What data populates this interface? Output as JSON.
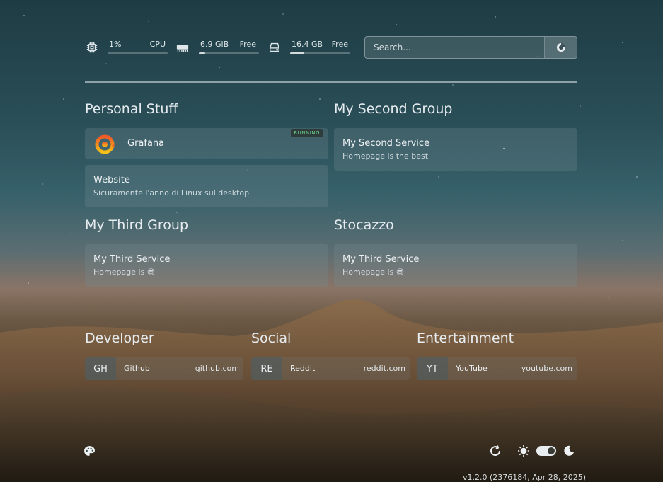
{
  "resources": {
    "cpu": {
      "value": "1%",
      "label": "CPU",
      "usage": 0.01,
      "icon": "cpu-icon"
    },
    "memory": {
      "value": "6.9 GiB",
      "label": "Free",
      "usage": 0.1,
      "icon": "memory-icon"
    },
    "disk": {
      "value": "16.4 GB",
      "label": "Free",
      "usage": 0.23,
      "icon": "disk-icon"
    }
  },
  "search": {
    "placeholder": "Search...",
    "button_icon": "search-provider-icon"
  },
  "groups": [
    {
      "title": "Personal Stuff",
      "services": [
        {
          "name": "Grafana",
          "description": "",
          "status": "RUNNING",
          "icon": "grafana-icon"
        },
        {
          "name": "Website",
          "description": "Sicuramente l'anno di Linux sul desktop"
        }
      ]
    },
    {
      "title": "My Second Group",
      "services": [
        {
          "name": "My Second Service",
          "description": "Homepage is the best"
        }
      ]
    },
    {
      "title": "My Third Group",
      "services": [
        {
          "name": "My Third Service",
          "description": "Homepage is 😎"
        }
      ]
    },
    {
      "title": "Stocazzo",
      "services": [
        {
          "name": "My Third Service",
          "description": "Homepage is 😎"
        }
      ]
    }
  ],
  "bookmarks": [
    {
      "title": "Developer",
      "items": [
        {
          "abbr": "GH",
          "name": "Github",
          "url": "github.com"
        }
      ]
    },
    {
      "title": "Social",
      "items": [
        {
          "abbr": "RE",
          "name": "Reddit",
          "url": "reddit.com"
        }
      ]
    },
    {
      "title": "Entertainment",
      "items": [
        {
          "abbr": "YT",
          "name": "YouTube",
          "url": "youtube.com"
        }
      ]
    }
  ],
  "footer": {
    "theme_icon": "palette-icon",
    "refresh_icon": "refresh-icon",
    "light_icon": "sun-icon",
    "dark_icon": "moon-icon",
    "dark_mode": true,
    "version": "v1.2.0 (2376184, Apr 28, 2025)"
  }
}
